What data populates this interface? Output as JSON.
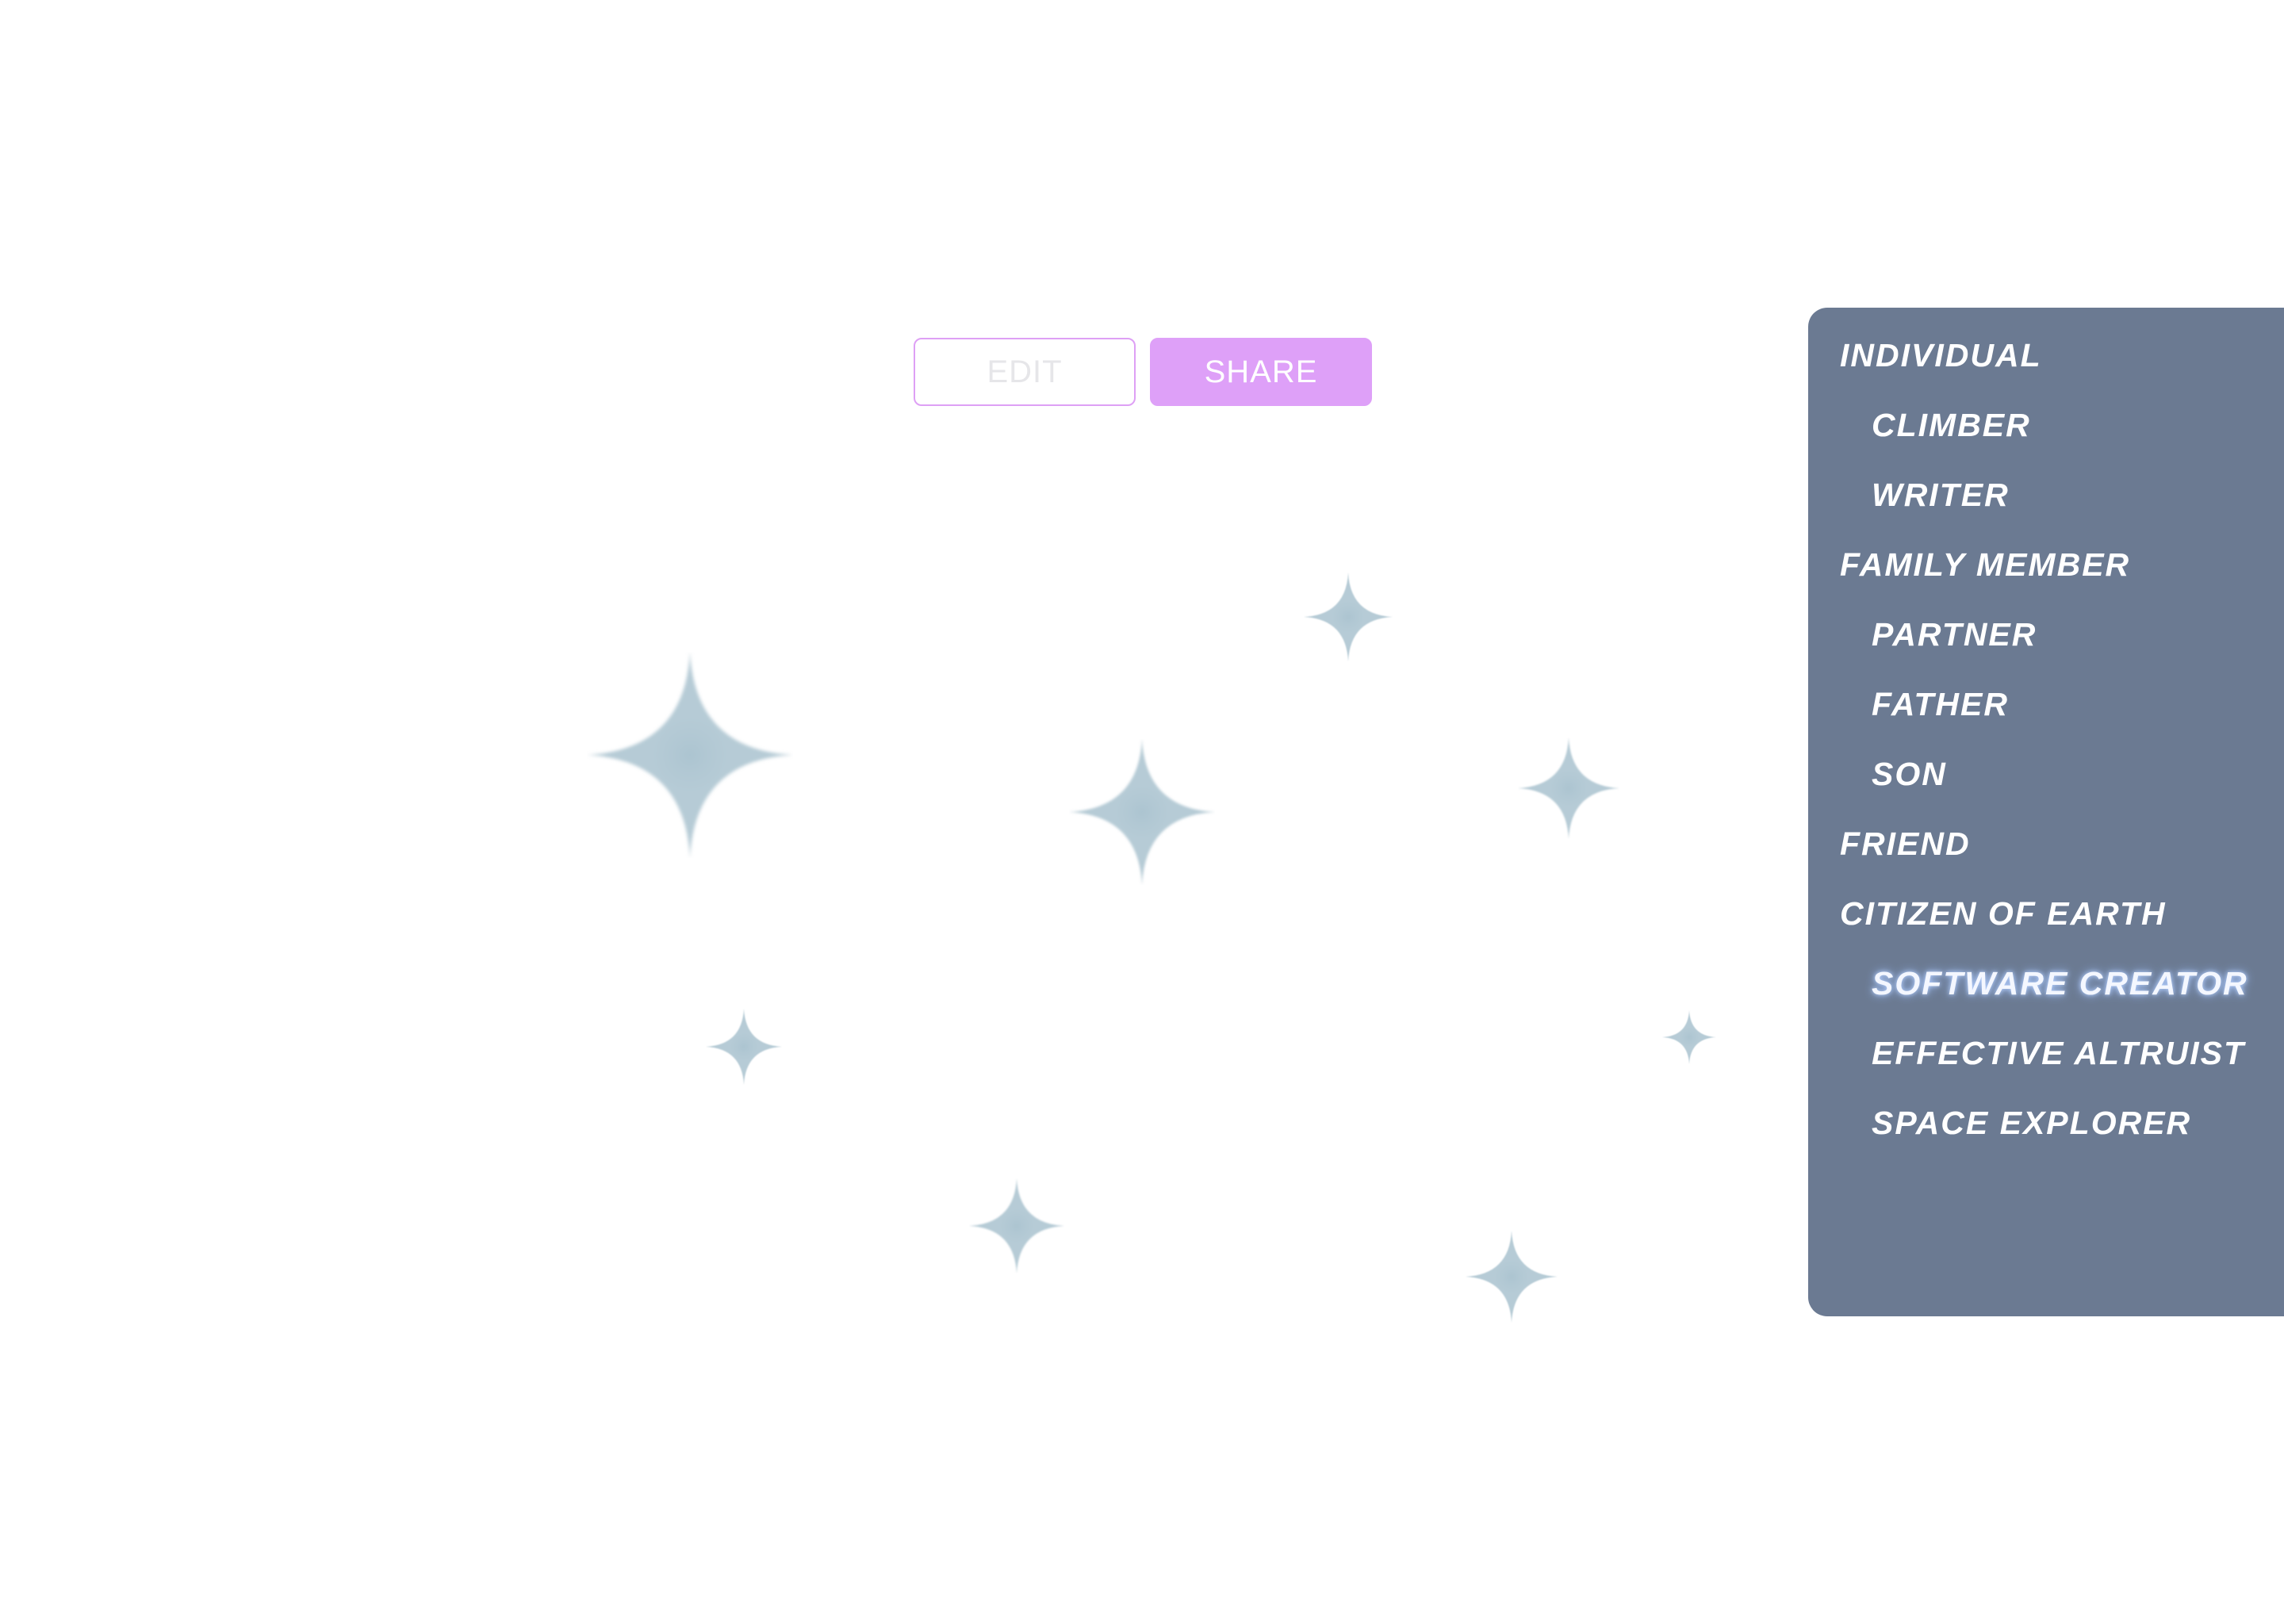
{
  "actions": {
    "edit_label": "EDIT",
    "share_label": "SHARE"
  },
  "menu": {
    "items": [
      {
        "label": "INDIVIDUAL",
        "level": 0,
        "active": false
      },
      {
        "label": "CLIMBER",
        "level": 1,
        "active": false
      },
      {
        "label": "WRITER",
        "level": 1,
        "active": false
      },
      {
        "label": "FAMILY MEMBER",
        "level": 0,
        "active": false
      },
      {
        "label": "PARTNER",
        "level": 1,
        "active": false
      },
      {
        "label": "FATHER",
        "level": 1,
        "active": false
      },
      {
        "label": "SON",
        "level": 1,
        "active": false
      },
      {
        "label": "FRIEND",
        "level": 0,
        "active": false
      },
      {
        "label": "CITIZEN OF EARTH",
        "level": 0,
        "active": false
      },
      {
        "label": "SOFTWARE CREATOR",
        "level": 1,
        "active": true
      },
      {
        "label": "EFFECTIVE ALTRUIST",
        "level": 1,
        "active": false
      },
      {
        "label": "SPACE EXPLORER",
        "level": 1,
        "active": false
      }
    ]
  },
  "colors": {
    "panel": "#6b7a92",
    "accent": "#dea0f8",
    "sparkle": "#a9c2cf"
  },
  "decor": {
    "sparkle_icon": "four-point-sparkle"
  }
}
